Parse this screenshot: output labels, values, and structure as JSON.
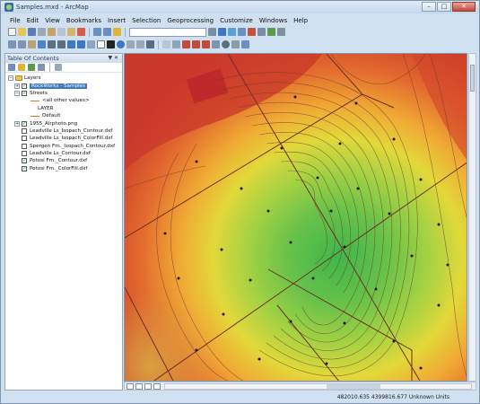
{
  "window": {
    "title": "Samples.mxd - ArcMap",
    "buttons": [
      "–",
      "□",
      "✕"
    ]
  },
  "menu": [
    "File",
    "Edit",
    "View",
    "Bookmarks",
    "Insert",
    "Selection",
    "Geoprocessing",
    "Customize",
    "Windows",
    "Help"
  ],
  "toc": {
    "title": "Table Of Contents",
    "pin": "▼ ✕",
    "root": "Layers",
    "items": [
      {
        "label": "RockWorks - Samples",
        "checked": true,
        "expander": "+",
        "selected": true
      },
      {
        "label": "Streets",
        "checked": true,
        "expander": "−"
      },
      {
        "label": "<all other values>",
        "kind": "legend"
      },
      {
        "label": "LAYER",
        "kind": "legend-heading"
      },
      {
        "label": "Default",
        "kind": "legend"
      },
      {
        "label": "1955_Airphoto.png",
        "checked": true,
        "expander": "+"
      },
      {
        "label": "Leadville Ls_Isopach_Contour.dxf",
        "checked": false
      },
      {
        "label": "Leadville Ls_Isopach_ColorFill.dxf",
        "checked": false
      },
      {
        "label": "Spergen Fm._Isopach_Contour.dxf",
        "checked": false
      },
      {
        "label": "Leadville Ls_Contour.dxf",
        "checked": false
      },
      {
        "label": "Potosi Fm._Contour.dxf",
        "checked": true
      },
      {
        "label": "Potosi Fm._ColorFill.dxf",
        "checked": true
      }
    ]
  },
  "status": {
    "coords": "482010.635  4399816.677 Unknown Units"
  },
  "colors": {
    "chrome": "#cfe0f1",
    "selection": "#3d78c4"
  }
}
